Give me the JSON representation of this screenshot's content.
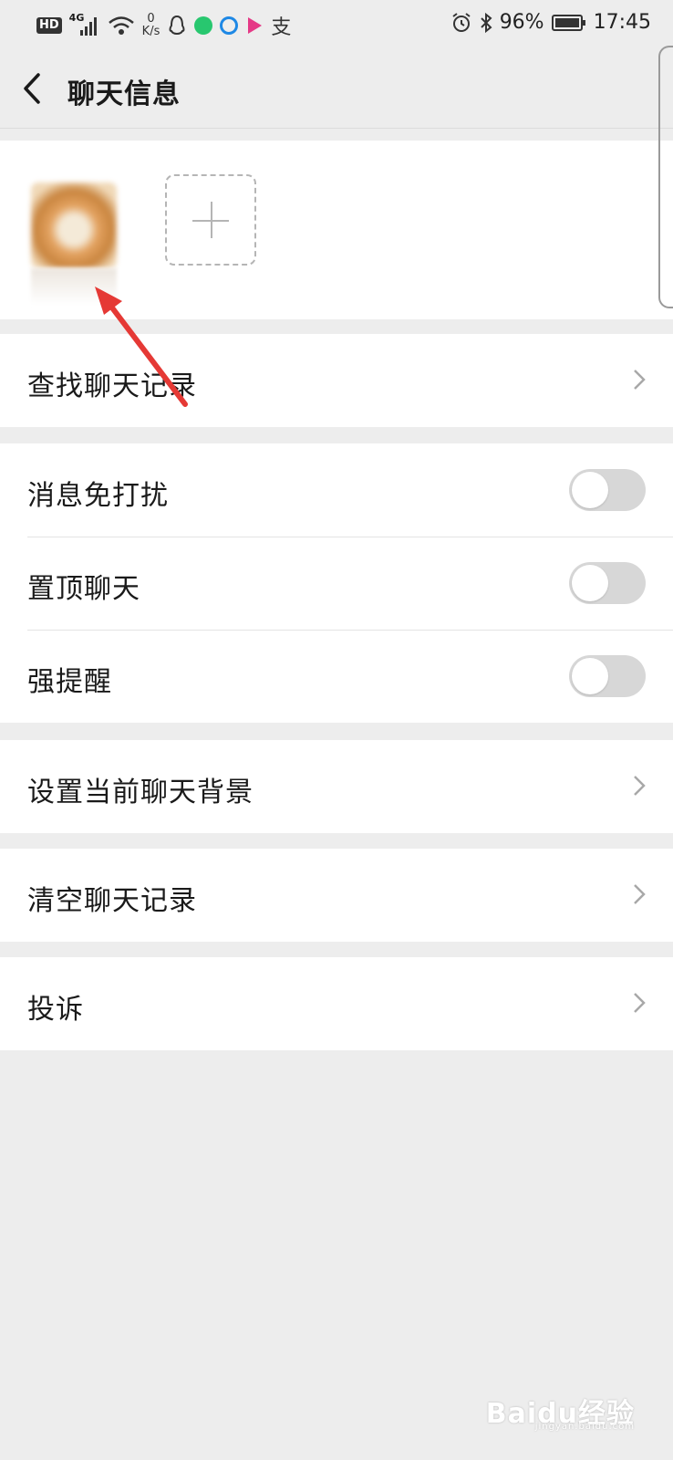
{
  "status_bar": {
    "hd": "HD",
    "network": "4G",
    "speed_value": "0",
    "speed_unit": "K/s",
    "battery": "96%",
    "time": "17:45",
    "alipay_char": "支"
  },
  "header": {
    "title": "聊天信息",
    "back_icon": "chevron-left-icon"
  },
  "members": {
    "add_icon": "plus-icon"
  },
  "settings": {
    "search_history": "查找聊天记录",
    "do_not_disturb": {
      "label": "消息免打扰",
      "on": false
    },
    "pin_chat": {
      "label": "置顶聊天",
      "on": false
    },
    "strong_reminder": {
      "label": "强提醒",
      "on": false
    },
    "chat_background": "设置当前聊天背景",
    "clear_history": "清空聊天记录",
    "complaint": "投诉"
  },
  "annotation": {
    "color": "#e53935"
  },
  "watermark": {
    "text": "Baidu经验",
    "url": "jingyan.baidu.com"
  }
}
